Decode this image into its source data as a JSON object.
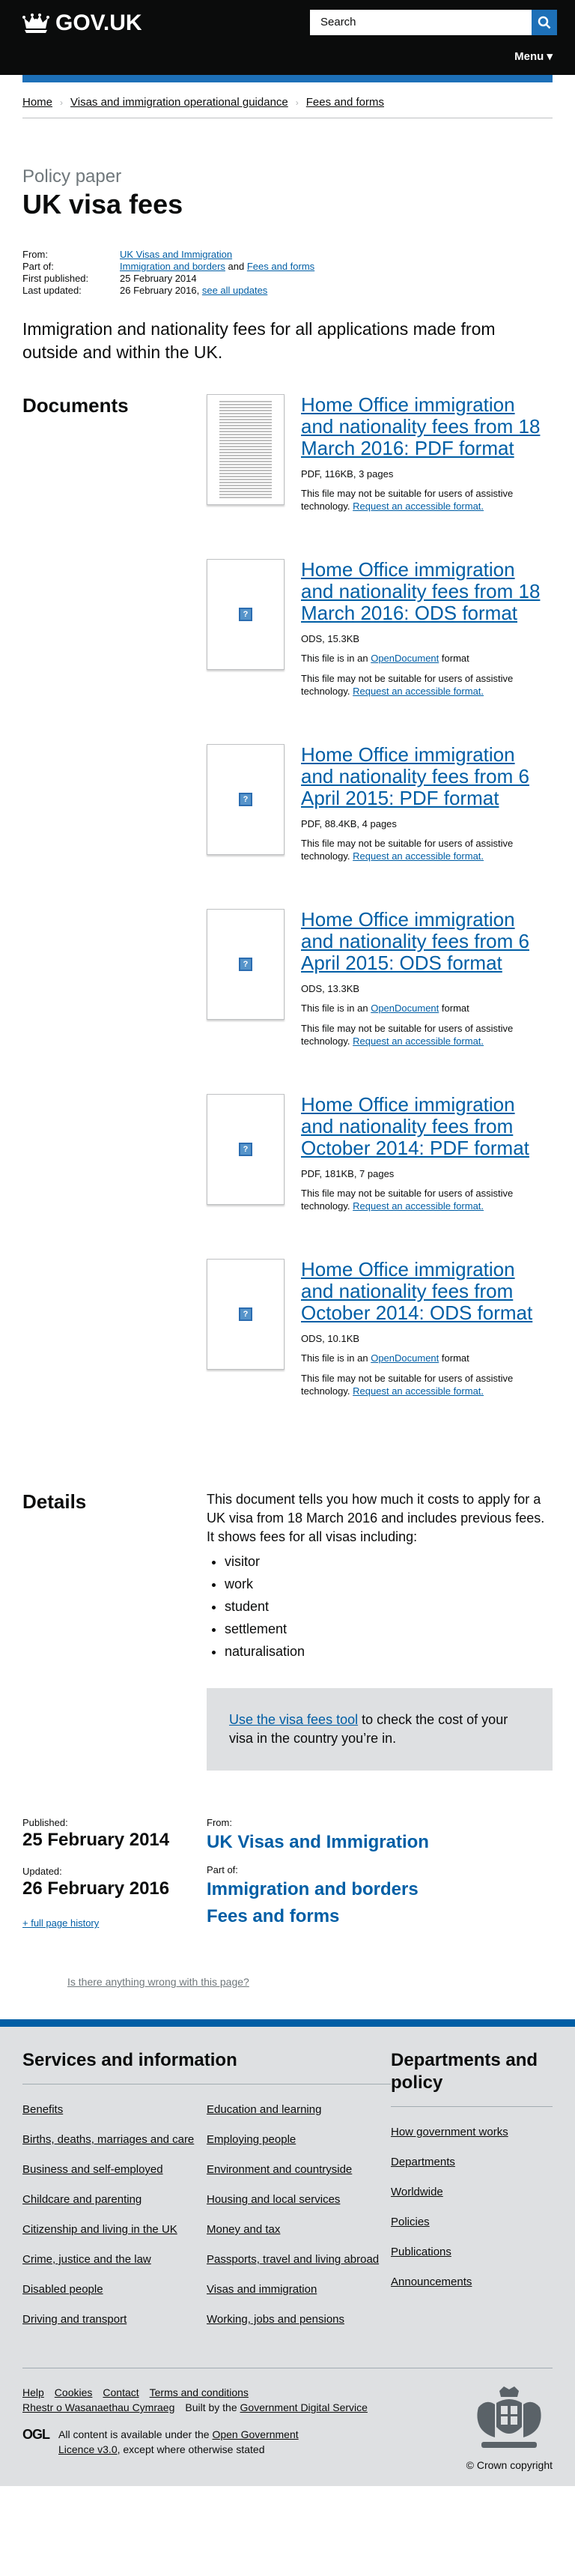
{
  "header": {
    "logo_text": "GOV.UK",
    "search_placeholder": "Search",
    "menu_label": "Menu ▾"
  },
  "breadcrumbs": [
    "Home",
    "Visas and immigration operational guidance",
    "Fees and forms"
  ],
  "page": {
    "doc_type": "Policy paper",
    "title": "UK visa fees"
  },
  "metadata": {
    "from_label": "From:",
    "from_value": "UK Visas and Immigration",
    "part_of_label": "Part of:",
    "part_of_link1": "Immigration and borders",
    "part_of_and": "and",
    "part_of_link2": "Fees and forms",
    "first_published_label": "First published:",
    "first_published_value": "25 February 2014",
    "last_updated_label": "Last updated:",
    "last_updated_value": "26 February 2016,",
    "see_all_updates": "see all updates"
  },
  "lede": "Immigration and nationality fees for all applications made from outside and within the UK.",
  "documents": {
    "heading": "Documents",
    "items": [
      {
        "title": "Home Office immigration and nationality fees from 18 March 2016: PDF format",
        "meta": "PDF, 116KB, 3 pages",
        "format_note_pre": "",
        "format_link": "",
        "format_note_post": "",
        "note": "This file may not be suitable for users of assistive technology.",
        "request": "Request an accessible format.",
        "thumb": "pdf"
      },
      {
        "title": "Home Office immigration and nationality fees from 18 March 2016: ODS format",
        "meta": "ODS, 15.3KB",
        "format_note_pre": "This file is in an",
        "format_link": "OpenDocument",
        "format_note_post": "format",
        "note": "This file may not be suitable for users of assistive technology.",
        "request": "Request an accessible format.",
        "thumb": "placeholder"
      },
      {
        "title": "Home Office immigration and nationality fees from 6 April 2015: PDF format",
        "meta": "PDF, 88.4KB, 4 pages",
        "format_note_pre": "",
        "format_link": "",
        "format_note_post": "",
        "note": "This file may not be suitable for users of assistive technology.",
        "request": "Request an accessible format.",
        "thumb": "placeholder"
      },
      {
        "title": "Home Office immigration and nationality fees from 6 April 2015: ODS format",
        "meta": "ODS, 13.3KB",
        "format_note_pre": "This file is in an",
        "format_link": "OpenDocument",
        "format_note_post": "format",
        "note": "This file may not be suitable for users of assistive technology.",
        "request": "Request an accessible format.",
        "thumb": "placeholder"
      },
      {
        "title": "Home Office immigration and nationality fees from October 2014: PDF format",
        "meta": "PDF, 181KB, 7 pages",
        "format_note_pre": "",
        "format_link": "",
        "format_note_post": "",
        "note": "This file may not be suitable for users of assistive technology.",
        "request": "Request an accessible format.",
        "thumb": "placeholder"
      },
      {
        "title": "Home Office immigration and nationality fees from October 2014: ODS format",
        "meta": "ODS, 10.1KB",
        "format_note_pre": "This file is in an",
        "format_link": "OpenDocument",
        "format_note_post": "format",
        "note": "This file may not be suitable for users of assistive technology.",
        "request": "Request an accessible format.",
        "thumb": "placeholder"
      }
    ]
  },
  "details": {
    "heading": "Details",
    "intro": "This document tells you how much it costs to apply for a UK visa from 18 March 2016 and includes previous fees. It shows fees for all visas including:",
    "list": [
      "visitor",
      "work",
      "student",
      "settlement",
      "naturalisation"
    ],
    "callout_link": "Use the visa fees tool",
    "callout_text": " to check the cost of your visa in the country you’re in."
  },
  "bottom_meta": {
    "published_label": "Published:",
    "published_value": "25 February 2014",
    "updated_label": "Updated:",
    "updated_value": "26 February 2016",
    "full_history": "+ full page history",
    "from_label": "From:",
    "from_value": "UK Visas and Immigration",
    "part_of_label": "Part of:",
    "part_of_1": "Immigration and borders",
    "part_of_2": "Fees and forms"
  },
  "report_link": "Is there anything wrong with this page?",
  "footer": {
    "services_heading": "Services and information",
    "services_col1": [
      "Benefits",
      "Births, deaths, marriages and care",
      "Business and self-employed",
      "Childcare and parenting",
      "Citizenship and living in the UK",
      "Crime, justice and the law",
      "Disabled people",
      "Driving and transport"
    ],
    "services_col2": [
      "Education and learning",
      "Employing people",
      "Environment and countryside",
      "Housing and local services",
      "Money and tax",
      "Passports, travel and living abroad",
      "Visas and immigration",
      "Working, jobs and pensions"
    ],
    "departments_heading": "Departments and policy",
    "departments": [
      "How government works",
      "Departments",
      "Worldwide",
      "Policies",
      "Publications",
      "Announcements"
    ],
    "links": [
      "Help",
      "Cookies",
      "Contact",
      "Terms and conditions"
    ],
    "welsh": "Rhestr o Wasanaethau Cymraeg",
    "built_by_pre": "Built by the",
    "built_by_link": "Government Digital Service",
    "ogl_mark": "OGL",
    "licence_pre": "All content is available under the",
    "licence_link": "Open Government Licence v3.0",
    "licence_post": ", except where otherwise stated",
    "copyright": "© Crown copyright"
  }
}
